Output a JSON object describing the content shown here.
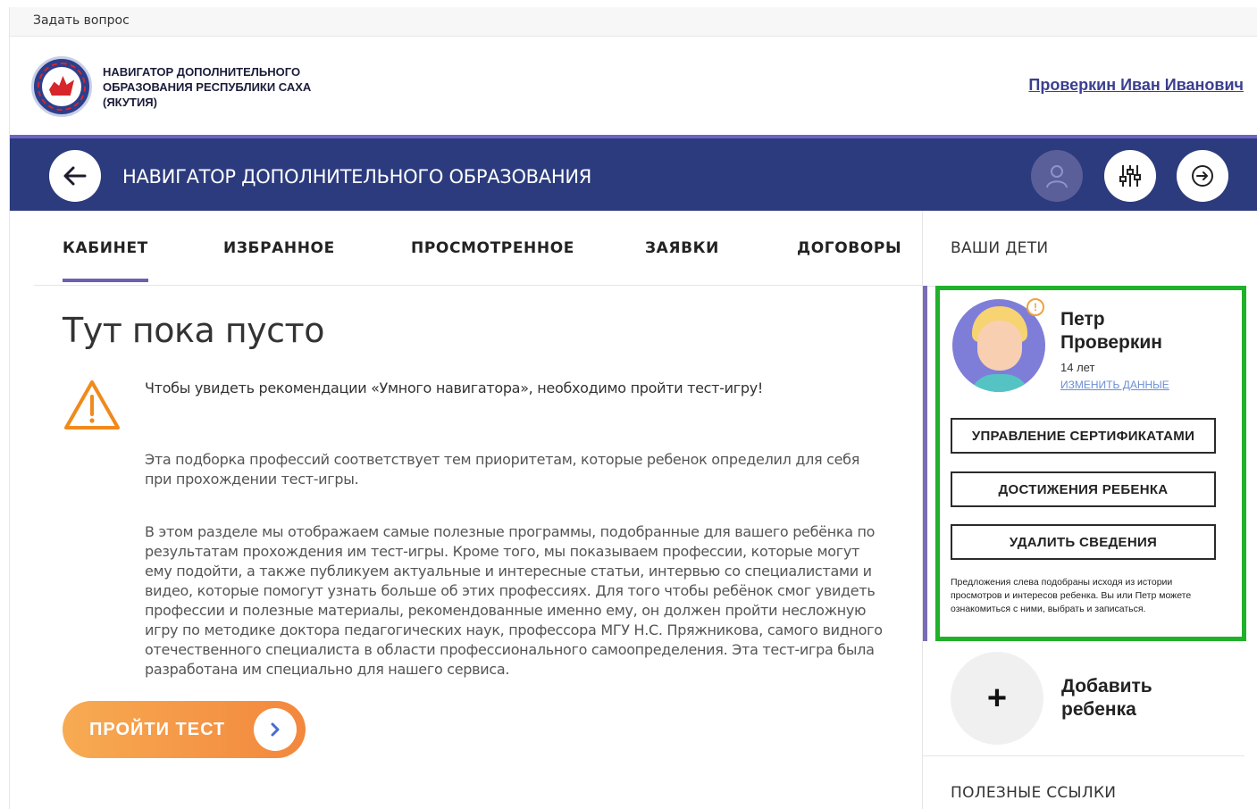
{
  "topbar": {
    "ask_link": "Задать вопрос"
  },
  "brand": {
    "title": "НАВИГАТОР ДОПОЛНИТЕЛЬНОГО ОБРАЗОВАНИЯ РЕСПУБЛИКИ САХА (ЯКУТИЯ)",
    "logo_icon": "republic-emblem"
  },
  "header": {
    "user_name": "Проверкин Иван Иванович"
  },
  "navbar": {
    "title": "НАВИГАТОР ДОПОЛНИТЕЛЬНОГО ОБРАЗОВАНИЯ",
    "back_icon": "arrow-left-icon",
    "actions": [
      "user-icon",
      "filter-icon",
      "logout-icon"
    ],
    "colors": {
      "background": "#2c3b7d",
      "accent": "#6b64c4"
    }
  },
  "tabs": [
    {
      "label": "Кабинет",
      "active": true
    },
    {
      "label": "Избранное",
      "active": false
    },
    {
      "label": "Просмотренное",
      "active": false
    },
    {
      "label": "Заявки",
      "active": false
    },
    {
      "label": "Договоры",
      "active": false
    }
  ],
  "main": {
    "empty_title": "Тут пока пусто",
    "warning_text": "Чтобы увидеть рекомендации «Умного навигатора», необходимо пройти тест-игру!",
    "paragraph_2": "Эта подборка профессий соответствует тем приоритетам, которые ребенок определил для себя при прохождении тест-игры.",
    "paragraph_3": "В этом разделе мы отображаем самые полезные программы, подобранные для вашего ребёнка по результатам прохождения им тест-игры. Кроме того, мы показываем профессии, которые могут ему подойти, а также публикуем актуальные и интересные статьи, интервью со специалистами и видео, которые помогут узнать больше об этих профессиях. Для того чтобы ребёнок смог увидеть профессии и полезные материалы, рекомендованные именно ему, он должен пройти несложную игру по методике доктора педагогических наук, профессора МГУ Н.С. Пряжникова, самого видного отечественного специалиста в области профессионального самоопределения. Эта тест-игра была разработана им специально для нашего сервиса.",
    "test_button": "ПРОЙТИ ТЕСТ"
  },
  "sidebar": {
    "heading": "Ваши дети",
    "child": {
      "name": "Петр Проверкин",
      "age": "14 лет",
      "edit_link": "изменить данные",
      "buttons": [
        "Управление сертификатами",
        "Достижения ребенка",
        "Удалить сведения"
      ],
      "note": "Предложения слева подобраны исходя из истории просмотров и интересов ребенка. Вы или Петр можете ознакомиться с ними, выбрать и записаться.",
      "highlight_color": "#1fb12a"
    },
    "add_child": {
      "symbol": "+",
      "label": "Добавить ребенка"
    },
    "links_heading": "Полезные ссылки"
  }
}
